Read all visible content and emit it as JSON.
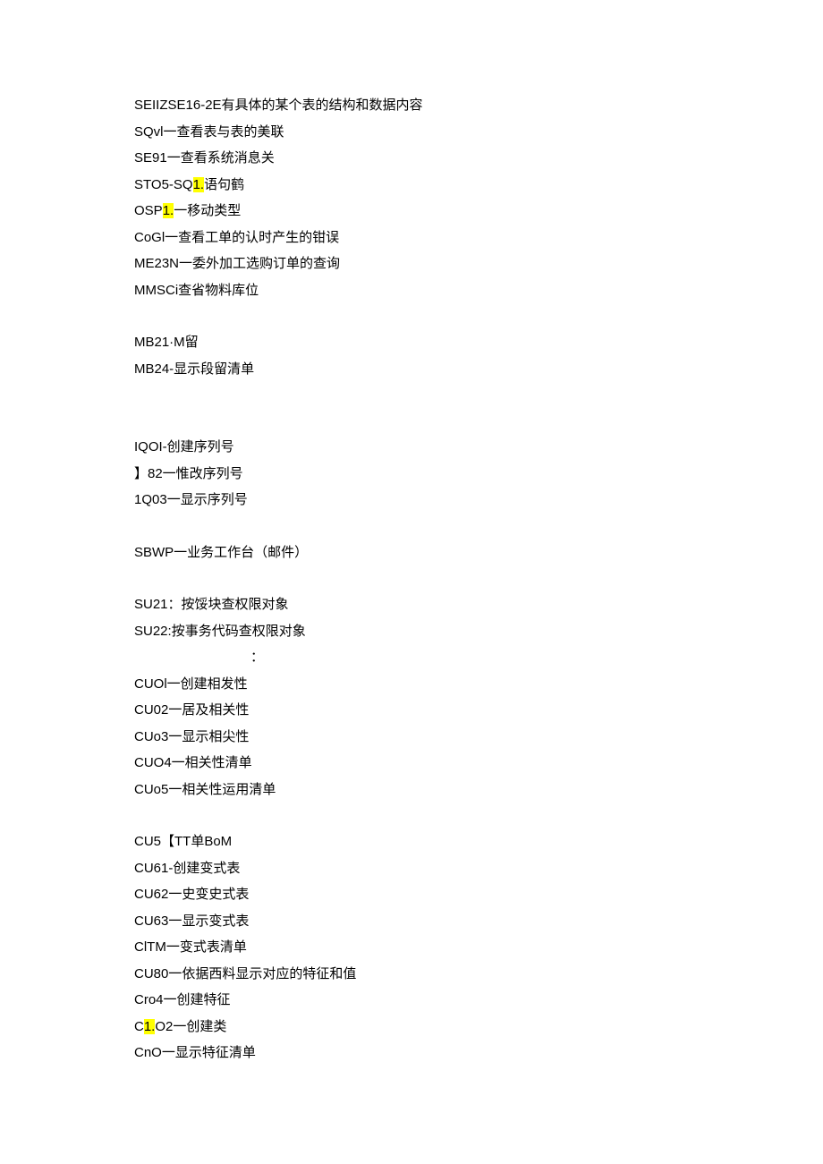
{
  "lines": {
    "l1": "SEIIZSE16-2E有具体的某个表的结构和数据内容",
    "l2": "SQvl一查看表与表的美联",
    "l3": "SE91一查看系统消息关",
    "l4a": "STO5-SQ",
    "l4b": "1.",
    "l4c": "语句鹤",
    "l5a": "OSP",
    "l5b": "1.",
    "l5c": "一移动类型",
    "l6": "CoGl一查看工单的认时产生的钳误",
    "l7": "ME23N一委外加工选购订单的查询",
    "l8": "MMSCi查省物料库位",
    "l9": "MB21·M留",
    "l10": "MB24-显示段留清单",
    "l11": "IQOI-创建序列号",
    "l12": "】82一惟改序列号",
    "l13": "1Q03一显示序列号",
    "l14": "SBWP一业务工作台（邮件）",
    "l15": "SU21：按馁块查权限对象",
    "l16": "SU22:按事务代码查权限对象",
    "colon": "：",
    "l17": "CUOl一创建相发性",
    "l18": "CU02一居及相关性",
    "l19": "CUo3一显示相尖性",
    "l20": "CUO4一相关性清单",
    "l21": "CUo5一相关性运用清单",
    "l22": "CU5【TT单BoM",
    "l23": "CU61-创建变式表",
    "l24": "CU62一史变史式表",
    "l25": "CU63一显示变式表",
    "l26": "ClTM一变式表清单",
    "l27": "CU80一依据西料显示对应的特征和值",
    "l28": "Cro4一创建特征",
    "l29a": "C",
    "l29b": "1.",
    "l29c": "O2一创建类",
    "l30": "CnO一显示特征清单"
  }
}
